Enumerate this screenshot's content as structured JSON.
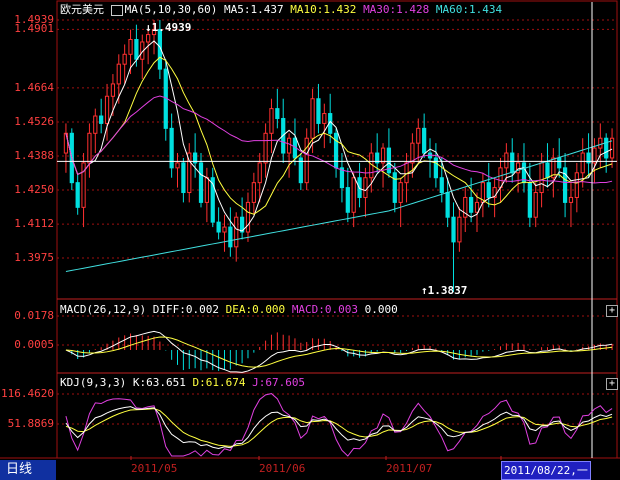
{
  "symbol": "欧元美元",
  "period_tab": "日线",
  "main": {
    "ma_header": "MA(5,10,30,60)",
    "ma5": "MA5:1.437",
    "ma10": "MA10:1.432",
    "ma30": "MA30:1.428",
    "ma60": "MA60:1.434",
    "yticks": [
      "1.4939",
      "1.4901",
      "1.4664",
      "1.4526",
      "1.4388",
      "1.4250",
      "1.4112",
      "1.3975"
    ],
    "high_label": "1.4939",
    "low_label": "1.3837"
  },
  "macd": {
    "header": "MACD(26,12,9)",
    "diff": "DIFF:0.002",
    "dea": "DEA:0.000",
    "macd": "MACD:0.003",
    "extra": "0.000",
    "yticks": [
      "0.0178",
      "0.0005"
    ]
  },
  "kdj": {
    "header": "KDJ(9,3,3)",
    "k": "K:63.651",
    "d": "D:61.674",
    "j": "J:67.605",
    "yticks": [
      "116.4620",
      "51.8869"
    ]
  },
  "xaxis": [
    "2011/05",
    "2011/06",
    "2011/07"
  ],
  "cursor_date": "2011/08/22,一",
  "colors": {
    "up": "#ff3030",
    "down": "#00e0e0",
    "ma5": "#ffffff",
    "ma10": "#ffff40",
    "ma30": "#e040e0",
    "ma60": "#40e0e0",
    "grid": "#a01010"
  },
  "chart_data": {
    "type": "candlestick",
    "ohlc": [
      [
        1.44,
        1.452,
        1.432,
        1.448
      ],
      [
        1.448,
        1.45,
        1.425,
        1.428
      ],
      [
        1.428,
        1.432,
        1.415,
        1.418
      ],
      [
        1.418,
        1.44,
        1.41,
        1.436
      ],
      [
        1.436,
        1.452,
        1.43,
        1.448
      ],
      [
        1.448,
        1.458,
        1.44,
        1.455
      ],
      [
        1.455,
        1.462,
        1.448,
        1.452
      ],
      [
        1.452,
        1.468,
        1.445,
        1.463
      ],
      [
        1.463,
        1.472,
        1.455,
        1.468
      ],
      [
        1.468,
        1.48,
        1.46,
        1.476
      ],
      [
        1.476,
        1.484,
        1.468,
        1.48
      ],
      [
        1.48,
        1.49,
        1.472,
        1.486
      ],
      [
        1.486,
        1.492,
        1.475,
        1.478
      ],
      [
        1.478,
        1.488,
        1.47,
        1.485
      ],
      [
        1.485,
        1.49,
        1.476,
        1.488
      ],
      [
        1.488,
        1.4939,
        1.48,
        1.49
      ],
      [
        1.49,
        1.4939,
        1.47,
        1.474
      ],
      [
        1.474,
        1.478,
        1.445,
        1.45
      ],
      [
        1.45,
        1.456,
        1.43,
        1.434
      ],
      [
        1.434,
        1.44,
        1.426,
        1.436
      ],
      [
        1.436,
        1.438,
        1.42,
        1.424
      ],
      [
        1.424,
        1.444,
        1.42,
        1.44
      ],
      [
        1.44,
        1.448,
        1.43,
        1.436
      ],
      [
        1.436,
        1.44,
        1.418,
        1.42
      ],
      [
        1.42,
        1.434,
        1.412,
        1.43
      ],
      [
        1.43,
        1.434,
        1.41,
        1.412
      ],
      [
        1.412,
        1.418,
        1.405,
        1.408
      ],
      [
        1.408,
        1.415,
        1.4,
        1.41
      ],
      [
        1.41,
        1.418,
        1.398,
        1.402
      ],
      [
        1.402,
        1.416,
        1.396,
        1.414
      ],
      [
        1.414,
        1.422,
        1.405,
        1.408
      ],
      [
        1.408,
        1.424,
        1.404,
        1.42
      ],
      [
        1.42,
        1.432,
        1.415,
        1.428
      ],
      [
        1.428,
        1.44,
        1.42,
        1.436
      ],
      [
        1.436,
        1.452,
        1.43,
        1.448
      ],
      [
        1.448,
        1.462,
        1.44,
        1.458
      ],
      [
        1.458,
        1.466,
        1.45,
        1.454
      ],
      [
        1.454,
        1.462,
        1.436,
        1.44
      ],
      [
        1.44,
        1.448,
        1.43,
        1.446
      ],
      [
        1.446,
        1.454,
        1.435,
        1.438
      ],
      [
        1.438,
        1.44,
        1.425,
        1.428
      ],
      [
        1.428,
        1.45,
        1.425,
        1.446
      ],
      [
        1.446,
        1.466,
        1.44,
        1.462
      ],
      [
        1.462,
        1.468,
        1.448,
        1.452
      ],
      [
        1.452,
        1.46,
        1.442,
        1.456
      ],
      [
        1.456,
        1.464,
        1.444,
        1.448
      ],
      [
        1.448,
        1.45,
        1.43,
        1.434
      ],
      [
        1.434,
        1.44,
        1.42,
        1.426
      ],
      [
        1.426,
        1.434,
        1.412,
        1.416
      ],
      [
        1.416,
        1.432,
        1.41,
        1.43
      ],
      [
        1.43,
        1.436,
        1.418,
        1.422
      ],
      [
        1.422,
        1.434,
        1.414,
        1.43
      ],
      [
        1.43,
        1.444,
        1.424,
        1.44
      ],
      [
        1.44,
        1.448,
        1.432,
        1.436
      ],
      [
        1.436,
        1.444,
        1.426,
        1.442
      ],
      [
        1.442,
        1.45,
        1.43,
        1.432
      ],
      [
        1.432,
        1.436,
        1.416,
        1.42
      ],
      [
        1.42,
        1.43,
        1.41,
        1.428
      ],
      [
        1.428,
        1.44,
        1.42,
        1.436
      ],
      [
        1.436,
        1.448,
        1.43,
        1.444
      ],
      [
        1.444,
        1.454,
        1.436,
        1.45
      ],
      [
        1.45,
        1.456,
        1.438,
        1.44
      ],
      [
        1.44,
        1.446,
        1.43,
        1.438
      ],
      [
        1.438,
        1.444,
        1.426,
        1.43
      ],
      [
        1.43,
        1.438,
        1.42,
        1.424
      ],
      [
        1.424,
        1.43,
        1.41,
        1.414
      ],
      [
        1.414,
        1.42,
        1.3837,
        1.404
      ],
      [
        1.404,
        1.418,
        1.4,
        1.414
      ],
      [
        1.414,
        1.426,
        1.408,
        1.422
      ],
      [
        1.422,
        1.43,
        1.412,
        1.416
      ],
      [
        1.416,
        1.424,
        1.408,
        1.42
      ],
      [
        1.42,
        1.432,
        1.414,
        1.428
      ],
      [
        1.428,
        1.436,
        1.418,
        1.422
      ],
      [
        1.422,
        1.43,
        1.414,
        1.426
      ],
      [
        1.426,
        1.438,
        1.42,
        1.434
      ],
      [
        1.434,
        1.444,
        1.428,
        1.44
      ],
      [
        1.44,
        1.446,
        1.428,
        1.432
      ],
      [
        1.432,
        1.44,
        1.424,
        1.436
      ],
      [
        1.436,
        1.444,
        1.424,
        1.428
      ],
      [
        1.428,
        1.436,
        1.41,
        1.414
      ],
      [
        1.414,
        1.428,
        1.41,
        1.424
      ],
      [
        1.424,
        1.44,
        1.418,
        1.436
      ],
      [
        1.436,
        1.444,
        1.426,
        1.43
      ],
      [
        1.43,
        1.442,
        1.422,
        1.438
      ],
      [
        1.438,
        1.446,
        1.43,
        1.434
      ],
      [
        1.434,
        1.44,
        1.414,
        1.42
      ],
      [
        1.42,
        1.428,
        1.41,
        1.422
      ],
      [
        1.422,
        1.436,
        1.416,
        1.432
      ],
      [
        1.432,
        1.446,
        1.426,
        1.44
      ],
      [
        1.44,
        1.448,
        1.43,
        1.436
      ],
      [
        1.436,
        1.446,
        1.428,
        1.442
      ],
      [
        1.442,
        1.452,
        1.434,
        1.446
      ],
      [
        1.446,
        1.448,
        1.432,
        1.438
      ],
      [
        1.438,
        1.45,
        1.434,
        1.446
      ]
    ],
    "ymin": 1.3837,
    "ymax": 1.4939
  }
}
